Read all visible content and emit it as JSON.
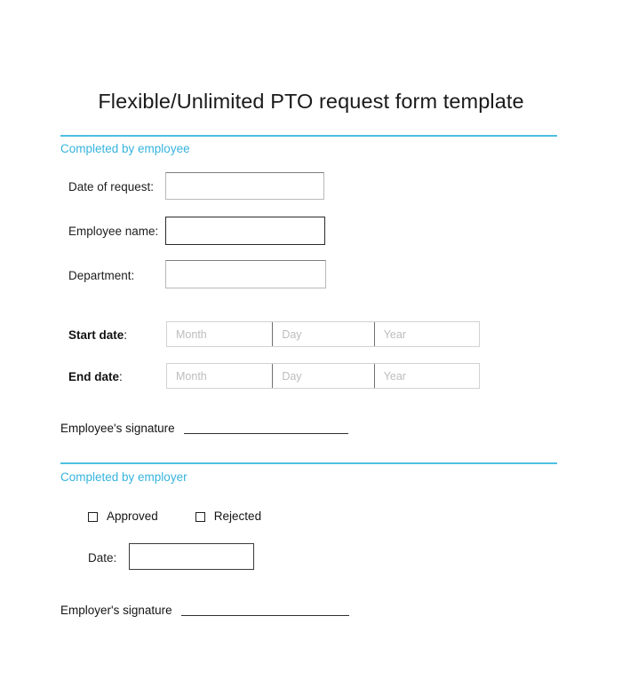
{
  "document": {
    "title": "Flexible/Unlimited PTO request form template"
  },
  "theme": {
    "accent": "#4ebfe2",
    "accent_text": "#36b3dd",
    "text": "#1a1a1a",
    "placeholder": "#bdbdbd",
    "background": "#ffffff"
  },
  "employee_section": {
    "heading": "Completed by employee",
    "fields": [
      {
        "label": "Date of request:",
        "value": ""
      },
      {
        "label": "Employee name:",
        "value": ""
      },
      {
        "label": "Department:",
        "value": ""
      }
    ],
    "date_rows": [
      {
        "label": "Start date",
        "colon": ":",
        "month_placeholder": "Month",
        "day_placeholder": "Day",
        "year_placeholder": "Year",
        "month_value": "",
        "day_value": "",
        "year_value": ""
      },
      {
        "label": "End date",
        "colon": ":",
        "month_placeholder": "Month",
        "day_placeholder": "Day",
        "year_placeholder": "Year",
        "month_value": "",
        "day_value": "",
        "year_value": ""
      }
    ],
    "signature_label": "Employee's signature"
  },
  "employer_section": {
    "heading": "Completed by employer",
    "decision_options": [
      {
        "label": "Approved",
        "checked": false
      },
      {
        "label": "Rejected",
        "checked": false
      }
    ],
    "date_field": {
      "label": "Date:",
      "value": ""
    },
    "signature_label": "Employer's signature"
  }
}
